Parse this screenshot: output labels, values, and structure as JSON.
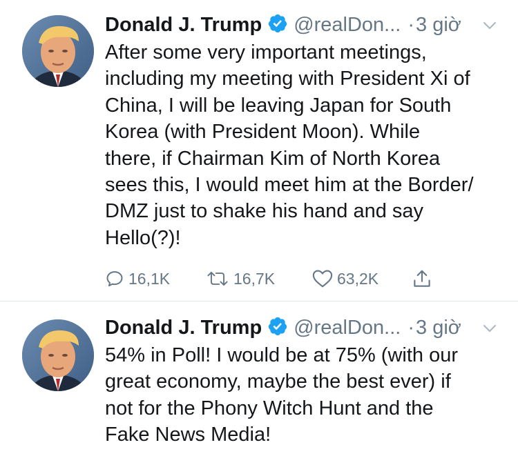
{
  "tweets": [
    {
      "name": "Donald J. Trump",
      "handle": "@realDon...",
      "dot": "·",
      "time": "3 giờ",
      "text_lines": [
        "After some very important meetings,",
        "including my meeting with President Xi of",
        "China, I will be leaving Japan for South",
        "Korea (with President Moon). While",
        "there, if Chairman Kim of North Korea",
        "sees this, I would meet him at the Border/",
        "DMZ just to shake his hand and say",
        "Hello(?)!"
      ],
      "replies": "16,1K",
      "retweets": "16,7K",
      "likes": "63,2K"
    },
    {
      "name": "Donald J. Trump",
      "handle": "@realDon...",
      "dot": "·",
      "time": "3 giờ",
      "text_lines": [
        "54% in Poll! I would be at 75% (with our",
        "great economy, maybe the best ever) if",
        "not for the Phony Witch Hunt and the",
        "Fake News Media!"
      ]
    }
  ],
  "icons": {
    "verified": "verified-badge-icon",
    "caret": "chevron-down-icon",
    "reply": "reply-icon",
    "retweet": "retweet-icon",
    "like": "heart-icon",
    "share": "share-icon"
  },
  "colors": {
    "text": "#14171a",
    "secondary": "#657786",
    "verified": "#1da1f2",
    "divider": "#e1e8ed"
  }
}
